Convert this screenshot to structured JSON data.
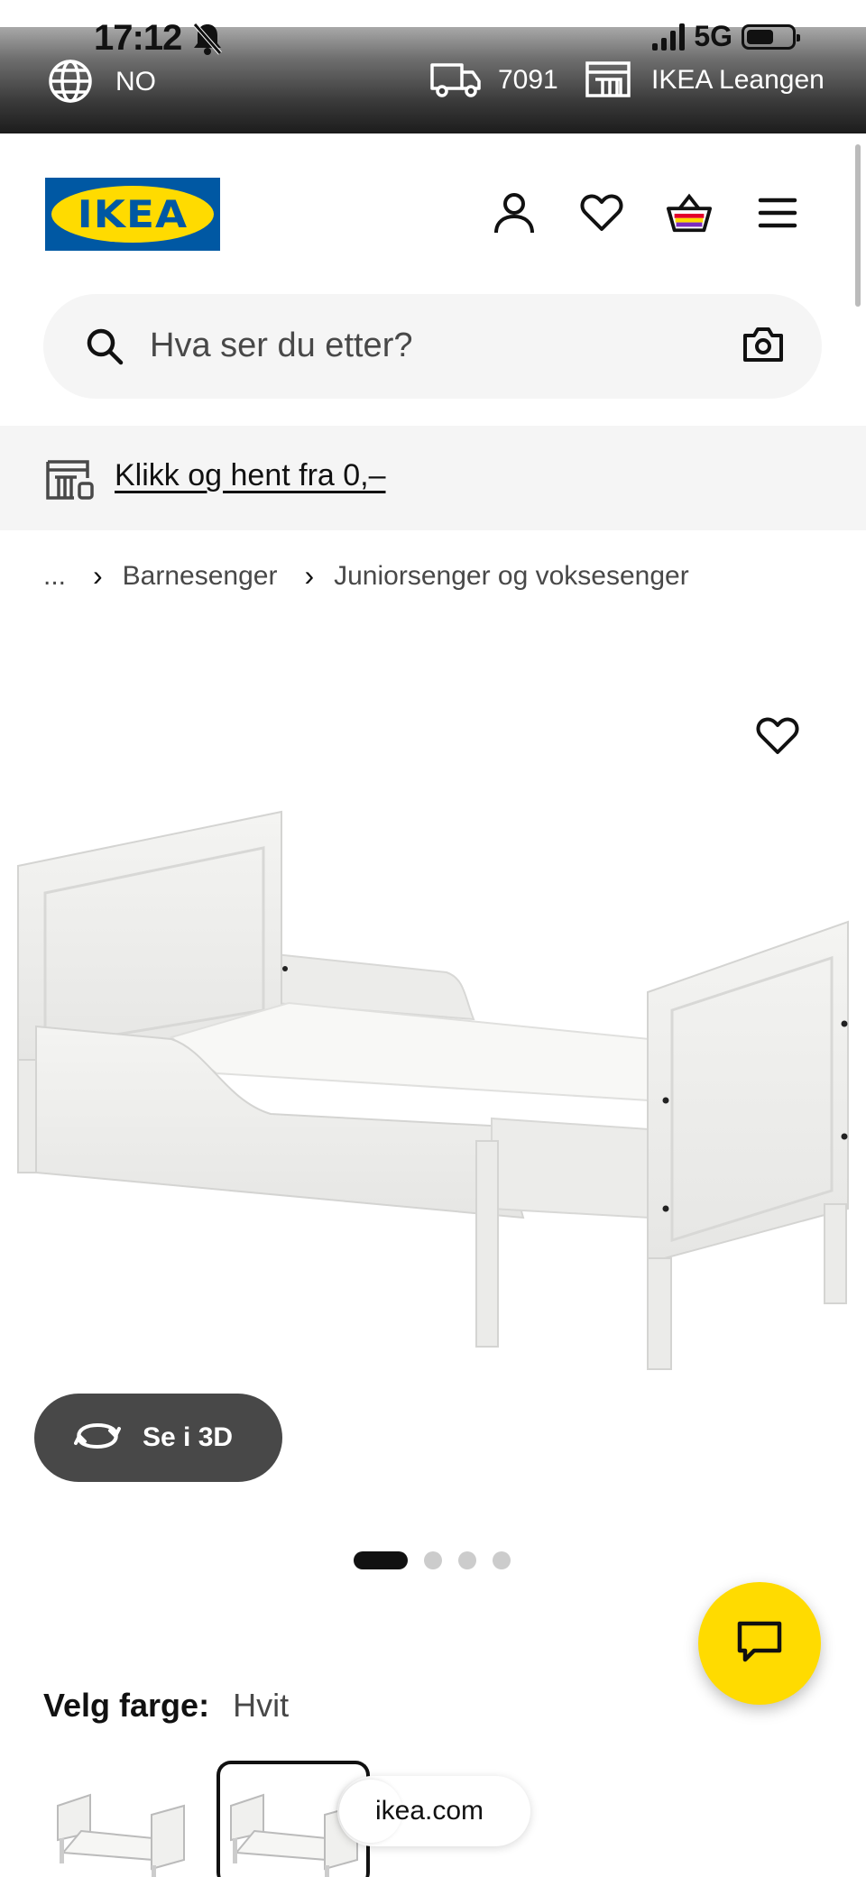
{
  "status_bar": {
    "time": "17:12",
    "network": "5G"
  },
  "topbar": {
    "country": "NO",
    "zip": "7091",
    "store": "IKEA Leangen"
  },
  "brand": {
    "logo_text": "IKEA"
  },
  "search": {
    "placeholder": "Hva ser du etter?"
  },
  "promo": {
    "click_collect": "Klikk og hent fra 0,–"
  },
  "breadcrumb": {
    "ellipsis": "...",
    "items": [
      "Barnesenger",
      "Juniorsenger og voksesenger"
    ]
  },
  "product": {
    "view_3d_label": "Se i 3D",
    "carousel_count": 4,
    "carousel_active_index": 0
  },
  "color_selector": {
    "label": "Velg farge:",
    "value": "Hvit"
  },
  "browser": {
    "url": "ikea.com"
  },
  "colors": {
    "ikea_blue": "#0058a3",
    "ikea_yellow": "#ffdb00",
    "dark_button": "#484848"
  }
}
